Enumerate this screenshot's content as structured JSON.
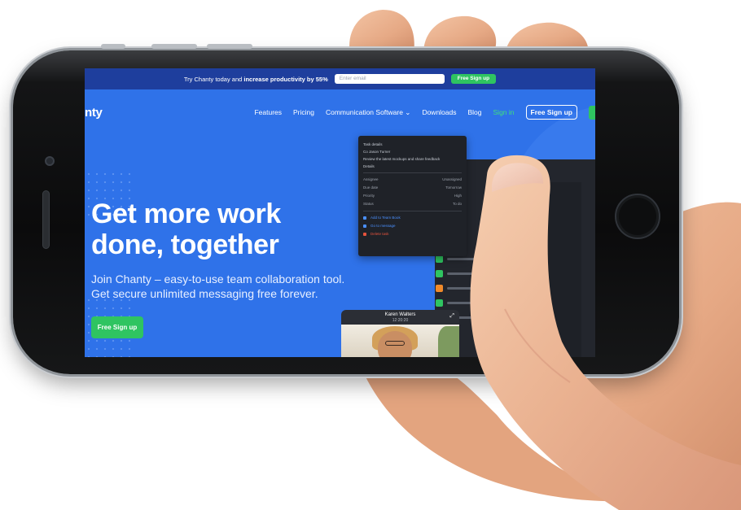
{
  "colors": {
    "hero_blue": "#2f72e9",
    "topbar_navy": "#1e3e9d",
    "brand_green": "#2fc461",
    "signin_green": "#3fe07c",
    "phone_black": "#0b0b0c",
    "skin": "#e9b08c"
  },
  "topbar": {
    "promo_prefix": "Try Chanty today and ",
    "promo_bold": "increase productivity by 55%",
    "email_placeholder": "Enter email",
    "signup_label": "Free Sign up"
  },
  "header": {
    "logo_text": "nty",
    "nav": {
      "features": "Features",
      "pricing": "Pricing",
      "communication": "Communication Software ⌄",
      "downloads": "Downloads",
      "blog": "Blog",
      "signin": "Sign in",
      "signup": "Free Sign up"
    }
  },
  "hero": {
    "title_line1": "Get more work",
    "title_line2": "done, together",
    "subtitle_line1": "Join Chanty – easy-to-use team collaboration tool.",
    "subtitle_line2": "Get secure unlimited messaging free forever.",
    "cta_label": "Free Sign up"
  },
  "app_mock": {
    "popup": {
      "header": "Task details",
      "owner": "Co Jason Turner",
      "description": "Review the latest mockups and share feedback",
      "section": "Details",
      "fields": [
        {
          "k": "Assignee",
          "v": "Unassigned"
        },
        {
          "k": "Due date",
          "v": "Tomorrow"
        },
        {
          "k": "Priority",
          "v": "High"
        },
        {
          "k": "Status",
          "v": "To do"
        }
      ],
      "actions": [
        "Add to Team Book",
        "Go to message",
        "Delete task"
      ]
    },
    "video_call": {
      "name": "Karen Walters",
      "time": "12:20:20"
    }
  }
}
